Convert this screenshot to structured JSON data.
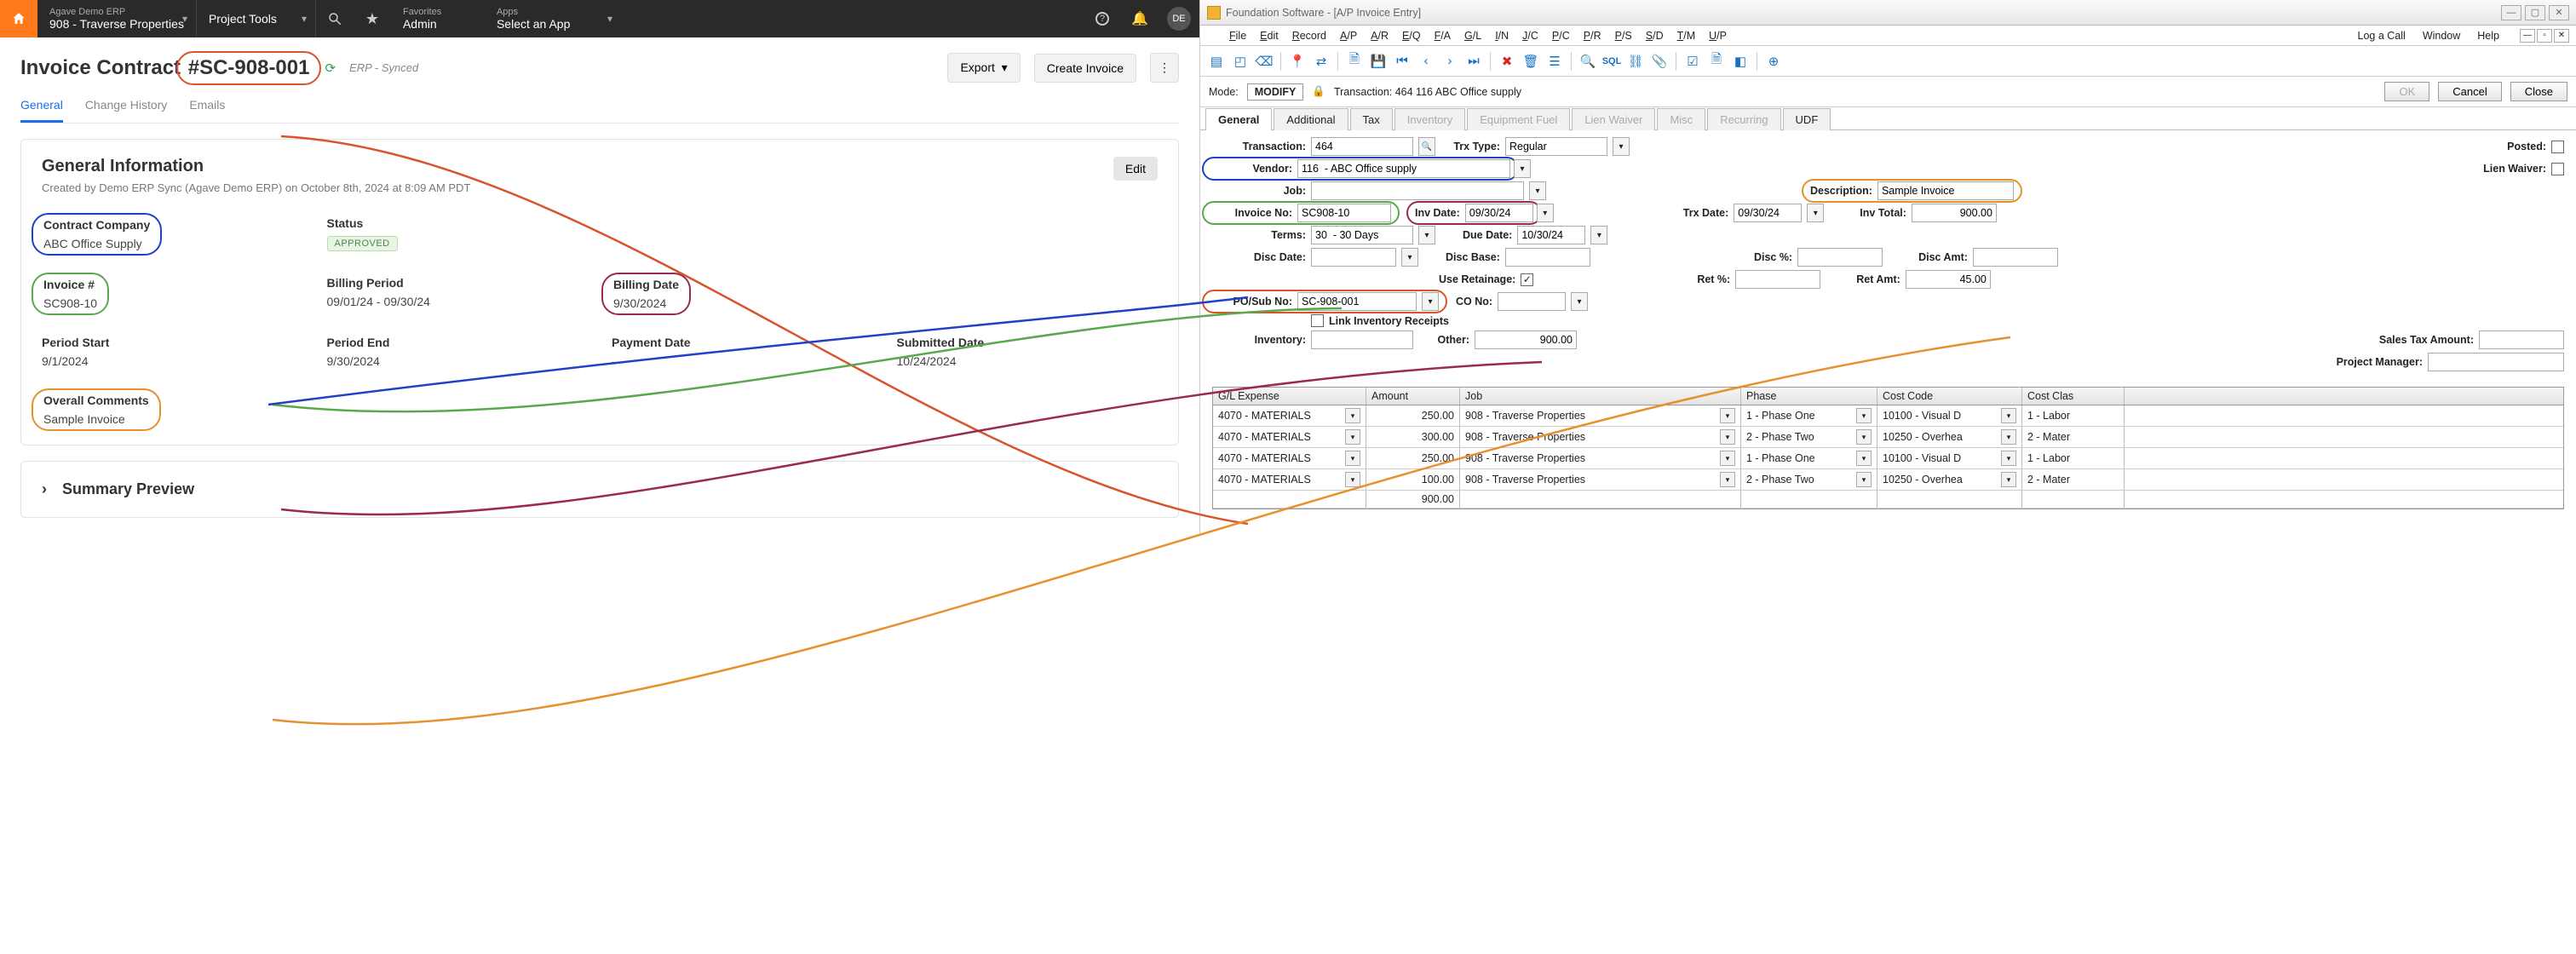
{
  "left": {
    "nav": {
      "home_icon": "home",
      "menu1_small": "Agave Demo ERP",
      "menu1_big": "908 - Traverse Properties",
      "menu2": "Project Tools",
      "fav_small": "Favorites",
      "fav_big": "Admin",
      "apps_small": "Apps",
      "apps_big": "Select an App",
      "avatar": "DE"
    },
    "title": "Invoice Contract #SC-908-001",
    "sync": "ERP - Synced",
    "actions": {
      "export": "Export",
      "create": "Create Invoice"
    },
    "tabs": [
      "General",
      "Change History",
      "Emails"
    ],
    "card": {
      "heading": "General Information",
      "subtitle": "Created by Demo ERP Sync (Agave Demo ERP) on October 8th, 2024 at 8:09 AM PDT",
      "edit": "Edit"
    },
    "fields": {
      "contract_company": {
        "lbl": "Contract Company",
        "val": "ABC Office Supply"
      },
      "status": {
        "lbl": "Status",
        "val": "APPROVED"
      },
      "invoice_no": {
        "lbl": "Invoice #",
        "val": "SC908-10"
      },
      "billing_period": {
        "lbl": "Billing Period",
        "val": "09/01/24 - 09/30/24"
      },
      "billing_date": {
        "lbl": "Billing Date",
        "val": "9/30/2024"
      },
      "period_start": {
        "lbl": "Period Start",
        "val": "9/1/2024"
      },
      "period_end": {
        "lbl": "Period End",
        "val": "9/30/2024"
      },
      "payment_date": {
        "lbl": "Payment Date",
        "val": "--"
      },
      "submitted_date": {
        "lbl": "Submitted Date",
        "val": "10/24/2024"
      },
      "comments": {
        "lbl": "Overall Comments",
        "val": "Sample Invoice"
      }
    },
    "summary": "Summary Preview"
  },
  "right": {
    "title": "Foundation Software - [A/P Invoice Entry]",
    "menubar": [
      "File",
      "Edit",
      "Record",
      "A/P",
      "A/R",
      "E/Q",
      "F/A",
      "G/L",
      "I/N",
      "J/C",
      "P/C",
      "P/R",
      "P/S",
      "S/D",
      "T/M",
      "U/P"
    ],
    "menubar_right": [
      "Log a Call",
      "Window",
      "Help"
    ],
    "mode_label": "Mode:",
    "mode_value": "MODIFY",
    "trx_label": "Transaction: 464   116  ABC Office supply",
    "btns": {
      "ok": "OK",
      "cancel": "Cancel",
      "close": "Close"
    },
    "formtabs": [
      {
        "label": "General",
        "state": "active"
      },
      {
        "label": "Additional",
        "state": ""
      },
      {
        "label": "Tax",
        "state": ""
      },
      {
        "label": "Inventory",
        "state": "dis"
      },
      {
        "label": "Equipment Fuel",
        "state": "dis"
      },
      {
        "label": "Lien Waiver",
        "state": "dis"
      },
      {
        "label": "Misc",
        "state": "dis"
      },
      {
        "label": "Recurring",
        "state": "dis"
      },
      {
        "label": "UDF",
        "state": ""
      }
    ],
    "form": {
      "transaction": "464",
      "trx_type": "Regular",
      "posted": false,
      "vendor": "116  - ABC Office supply",
      "lien_waiver": false,
      "job": "",
      "description": "Sample Invoice",
      "invoice_no": "SC908-10",
      "inv_date": "09/30/24",
      "trx_date": "09/30/24",
      "inv_total": "900.00",
      "terms": "30  - 30 Days",
      "due_date": "10/30/24",
      "disc_date": "",
      "disc_base": "",
      "disc_pct": "",
      "disc_amt": "",
      "use_retainage": true,
      "ret_pct": "",
      "ret_amt": "45.00",
      "po_sub_no": "SC-908-001",
      "co_no": "",
      "link_inv": "Link Inventory Receipts",
      "inventory": "",
      "other": "900.00",
      "sales_tax_amt": "",
      "project_manager": ""
    },
    "form_labels": {
      "transaction": "Transaction:",
      "trx_type": "Trx Type:",
      "posted": "Posted:",
      "vendor": "Vendor:",
      "lien_waiver": "Lien Waiver:",
      "job": "Job:",
      "description": "Description:",
      "invoice_no": "Invoice No:",
      "inv_date": "Inv Date:",
      "trx_date": "Trx Date:",
      "inv_total": "Inv Total:",
      "terms": "Terms:",
      "due_date": "Due Date:",
      "disc_date": "Disc Date:",
      "disc_base": "Disc Base:",
      "disc_pct": "Disc %:",
      "disc_amt": "Disc Amt:",
      "use_retainage": "Use Retainage:",
      "ret_pct": "Ret %:",
      "ret_amt": "Ret Amt:",
      "po_sub_no": "PO/Sub No:",
      "co_no": "CO No:",
      "inventory": "Inventory:",
      "other": "Other:",
      "sales_tax_amt": "Sales Tax Amount:",
      "project_manager": "Project Manager:"
    },
    "grid": {
      "cols": [
        "G/L Expense",
        "Amount",
        "Job",
        "Phase",
        "Cost Code",
        "Cost Clas"
      ],
      "rows": [
        {
          "gl": "4070  - MATERIALS",
          "amt": "250.00",
          "job": "908  - Traverse Properties",
          "ph": "1  - Phase One",
          "cc": "10100  - Visual D",
          "ccl": "1  - Labor"
        },
        {
          "gl": "4070  - MATERIALS",
          "amt": "300.00",
          "job": "908  - Traverse Properties",
          "ph": "2  - Phase Two",
          "cc": "10250  - Overhea",
          "ccl": "2  - Mater"
        },
        {
          "gl": "4070  - MATERIALS",
          "amt": "250.00",
          "job": "908  - Traverse Properties",
          "ph": "1  - Phase One",
          "cc": "10100  - Visual D",
          "ccl": "1  - Labor"
        },
        {
          "gl": "4070  - MATERIALS",
          "amt": "100.00",
          "job": "908  - Traverse Properties",
          "ph": "2  - Phase Two",
          "cc": "10250  - Overhea",
          "ccl": "2  - Mater"
        }
      ],
      "total": "900.00"
    }
  }
}
